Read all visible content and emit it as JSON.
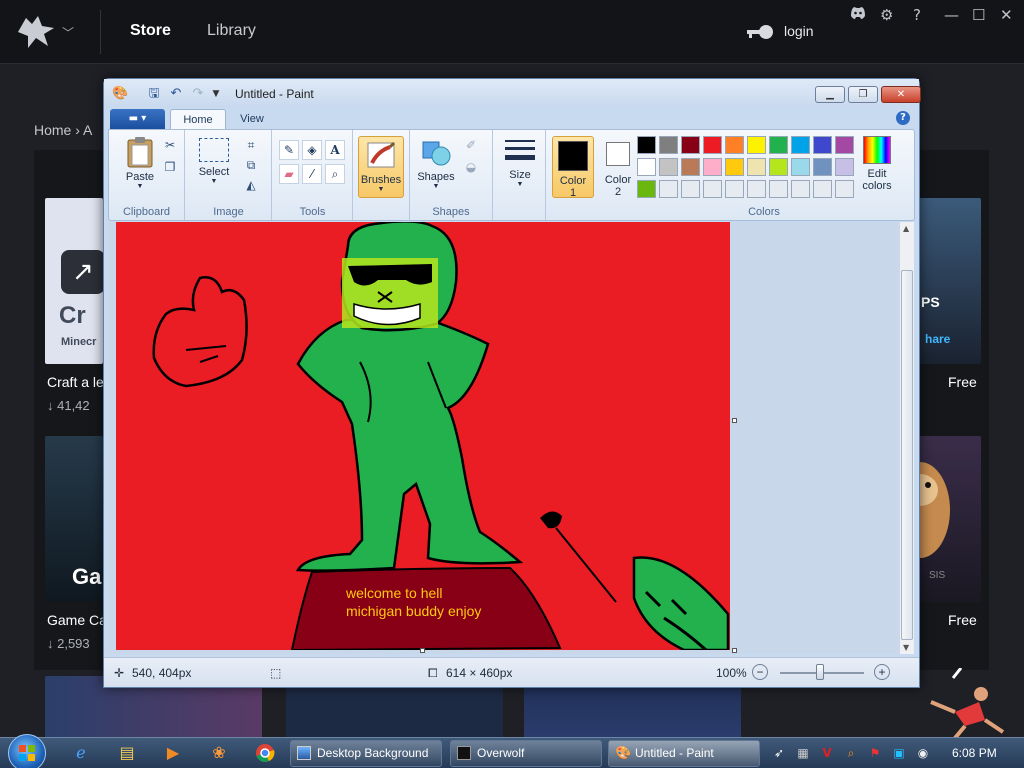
{
  "overwolf": {
    "nav": {
      "store": "Store",
      "library": "Library",
      "login": "login"
    },
    "window_controls": {
      "help": "?",
      "minimize": "—",
      "maximize": "☐",
      "close": "✕"
    },
    "breadcrumb": "Home  ›  A",
    "cards": [
      {
        "title": "Craft a le",
        "downloads": "↓ 41,42",
        "logo_text": "Cr",
        "logo_sub": "Minecr",
        "logo_icon": "pickaxe-icon"
      },
      {
        "title": "Game Ca",
        "downloads": "↓ 2,593",
        "logo_text": "Ga"
      }
    ],
    "right_cards": [
      {
        "price": "Free",
        "badge_text": "PS",
        "badge_sub": "hare"
      },
      {
        "price": "Free",
        "badge_text": "SIS"
      }
    ]
  },
  "paint": {
    "title": "Untitled - Paint",
    "tabs": [
      "Home",
      "View"
    ],
    "ribbon": {
      "groups": {
        "clipboard": {
          "label": "Clipboard",
          "paste": "Paste"
        },
        "image": {
          "label": "Image",
          "select": "Select"
        },
        "tools": {
          "label": "Tools"
        },
        "brushes": {
          "label": "Brushes"
        },
        "shapes": {
          "label": "Shapes",
          "shapes_btn": "Shapes",
          "size": "Size"
        },
        "colors": {
          "label": "Colors",
          "color1": "Color",
          "color1_num": "1",
          "color2": "Color",
          "color2_num": "2",
          "edit": "Edit",
          "edit2": "colors"
        }
      },
      "palette": [
        "#000000",
        "#7f7f7f",
        "#880015",
        "#ed1c24",
        "#ff7f27",
        "#fff200",
        "#22b14c",
        "#00a2e8",
        "#3f48cc",
        "#a349a4",
        "#ffffff",
        "#c3c3c3",
        "#b97a57",
        "#ffaec9",
        "#ffc90e",
        "#efe4b0",
        "#b5e61d",
        "#99d9ea",
        "#7092be",
        "#c8bfe7",
        "#6ab70e",
        "#e6ebf2",
        "#e6ebf2",
        "#e6ebf2",
        "#e6ebf2",
        "#e6ebf2",
        "#e6ebf2",
        "#e6ebf2",
        "#e6ebf2",
        "#e6ebf2"
      ],
      "color1_value": "#000000",
      "color2_value": "#ffffff"
    },
    "canvas": {
      "text_line1": "welcome to hell",
      "text_line2": "michigan buddy enjoy",
      "colors": {
        "background": "#ea1c24",
        "figure": "#22b14c",
        "sign": "#880015",
        "sign_text": "#ffc90e"
      }
    },
    "status": {
      "cursor": "540, 404px",
      "size": "614 × 460px",
      "zoom": "100%"
    }
  },
  "taskbar": {
    "tasks": [
      "Desktop Background",
      "Overwolf",
      "Untitled - Paint"
    ],
    "time": "6:08 PM"
  }
}
